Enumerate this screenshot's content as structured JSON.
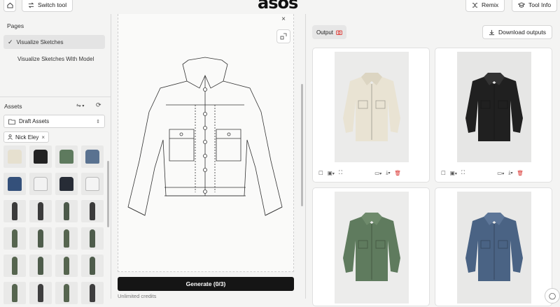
{
  "topbar": {
    "switch_label": "Switch tool",
    "logo": "asos",
    "remix_label": "Remix",
    "info_label": "Tool Info"
  },
  "pages": {
    "title": "Pages",
    "items": [
      {
        "label": "Visualize Sketches",
        "active": true
      },
      {
        "label": "Visualize Sketches With Model",
        "active": false
      }
    ]
  },
  "assets": {
    "title": "Assets",
    "folder": "Draft Assets",
    "user_filter": "Nick Eley",
    "thumbnails": [
      {
        "kind": "jacket",
        "color": "#e6e0cf"
      },
      {
        "kind": "jacket",
        "color": "#222222"
      },
      {
        "kind": "jacket",
        "color": "#5e7a5e"
      },
      {
        "kind": "jacket",
        "color": "#5a7290"
      },
      {
        "kind": "jacket",
        "color": "#34507a"
      },
      {
        "kind": "jacket",
        "color": "#f2f2f2"
      },
      {
        "kind": "jacket",
        "color": "#272c36"
      },
      {
        "kind": "jacket",
        "color": "#f4f4f4"
      },
      {
        "kind": "person",
        "color": "#3b3b3b"
      },
      {
        "kind": "person",
        "color": "#3b3b3b"
      },
      {
        "kind": "person",
        "color": "#4c5a4a"
      },
      {
        "kind": "person",
        "color": "#3b3b3b"
      },
      {
        "kind": "person",
        "color": "#56654f"
      },
      {
        "kind": "person",
        "color": "#4e5c4b"
      },
      {
        "kind": "person",
        "color": "#56654f"
      },
      {
        "kind": "person",
        "color": "#4e5c4b"
      },
      {
        "kind": "person",
        "color": "#56654f"
      },
      {
        "kind": "person",
        "color": "#4e5c4b"
      },
      {
        "kind": "person",
        "color": "#56654f"
      },
      {
        "kind": "person",
        "color": "#4e5c4b"
      },
      {
        "kind": "person",
        "color": "#56654f"
      },
      {
        "kind": "person",
        "color": "#3e3e3e"
      },
      {
        "kind": "person",
        "color": "#56654f"
      },
      {
        "kind": "person",
        "color": "#3e3e3e"
      }
    ]
  },
  "canvas": {
    "generate_label": "Generate",
    "generate_count": "(0/3)",
    "credits": "Unlimited credits"
  },
  "output": {
    "badge": "Output",
    "download_label": "Download outputs",
    "cards": [
      {
        "color": "#e9e3d3",
        "collar": "#dcd5c2",
        "bg": "#ebebea"
      },
      {
        "color": "#202020",
        "collar": "#333333",
        "bg": "#e6e6e5"
      },
      {
        "color": "#5f7b5e",
        "collar": "#6f8b6c",
        "bg": "#ececeb"
      },
      {
        "color": "#4a6384",
        "collar": "#5d7698",
        "bg": "#e8e8e7"
      }
    ]
  },
  "colors": {
    "accent_icon": "#e0403a",
    "primary": "#151515"
  }
}
